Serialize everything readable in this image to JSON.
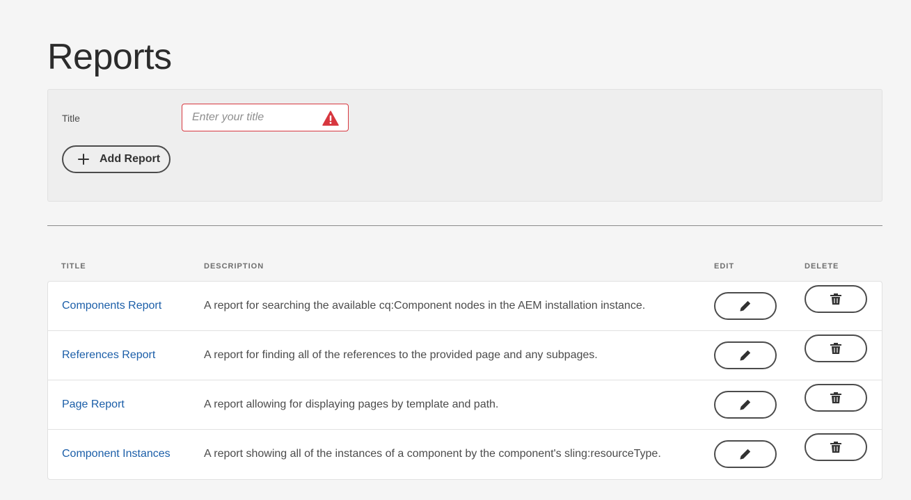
{
  "page": {
    "title": "Reports"
  },
  "form": {
    "title_label": "Title",
    "title_placeholder": "Enter your title",
    "title_value": "",
    "add_button_label": "Add Report",
    "icons": {
      "alert": "alert-icon",
      "add": "plus-icon"
    },
    "error_color": "#d7373f"
  },
  "table": {
    "headers": {
      "title": "TITLE",
      "description": "DESCRIPTION",
      "edit": "EDIT",
      "delete": "DELETE"
    },
    "rows": [
      {
        "title": "Components Report",
        "description": "A report for searching the available cq:Component nodes in the AEM installation instance."
      },
      {
        "title": "References Report",
        "description": "A report for finding all of the references to the provided page and any subpages."
      },
      {
        "title": "Page Report",
        "description": "A report allowing for displaying pages by template and path."
      },
      {
        "title": "Component Instances",
        "description": "A report showing all of the instances of a component by the component's sling:resourceType."
      }
    ],
    "icons": {
      "edit": "pencil-icon",
      "delete": "trash-icon"
    },
    "link_color": "#1b5ea8"
  }
}
